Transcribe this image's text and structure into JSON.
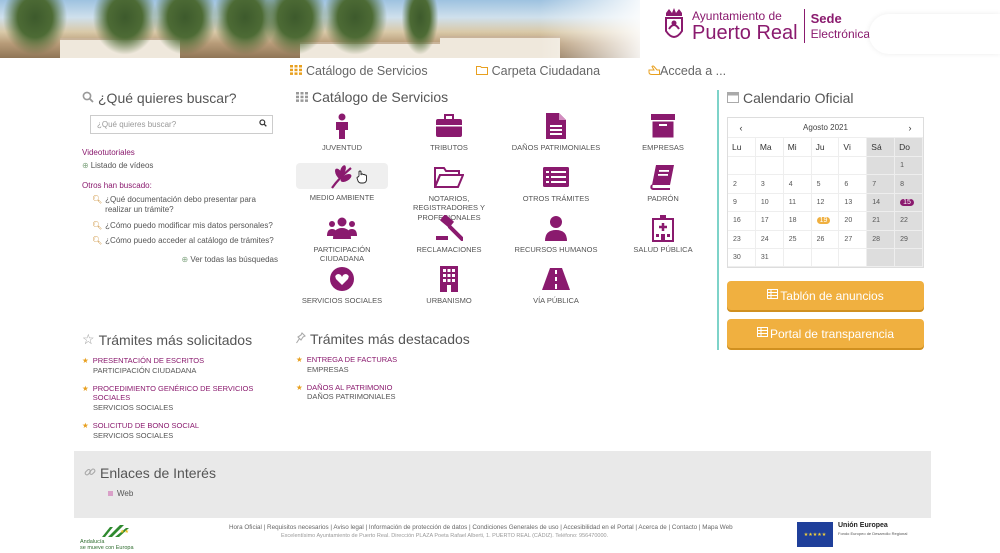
{
  "colors": {
    "brand": "#8a1a6e",
    "accent": "#f0b040",
    "divider": "#7ed3c9"
  },
  "header": {
    "logo_line1": "Ayuntamiento de",
    "logo_line2": "Puerto Real",
    "sede_line1": "Sede",
    "sede_line2": "Electrónica"
  },
  "topnav": [
    {
      "label": "Catálogo de Servicios",
      "icon": "grid-icon"
    },
    {
      "label": "Carpeta Ciudadana",
      "icon": "folder-icon"
    },
    {
      "label": "Acceda a ...",
      "icon": "hand-pointer-icon"
    }
  ],
  "search": {
    "heading": "¿Qué quieres buscar?",
    "placeholder": "¿Qué quieres buscar?",
    "videotutoriales": "Videotutoriales",
    "listado_videos": "Listado de vídeos",
    "otros_title": "Otros han buscado:",
    "queries": [
      "¿Qué documentación debo presentar para realizar un trámite?",
      "¿Cómo puedo modificar mis datos personales?",
      "¿Cómo puedo acceder al catálogo de trámites?"
    ],
    "ver_todas": "Ver todas las búsquedas"
  },
  "catalog": {
    "heading": "Catálogo de Servicios",
    "items": [
      {
        "label": "JUVENTUD",
        "icon": "person-icon"
      },
      {
        "label": "TRIBUTOS",
        "icon": "briefcase-icon"
      },
      {
        "label": "DAÑOS PATRIMONIALES",
        "icon": "document-icon"
      },
      {
        "label": "EMPRESAS",
        "icon": "archive-box-icon"
      },
      {
        "label": "MEDIO AMBIENTE",
        "icon": "leaf-icon"
      },
      {
        "label": "NOTARIOS, REGISTRADORES Y PROFESIONALES",
        "icon": "folder-open-icon"
      },
      {
        "label": "OTROS TRÁMITES",
        "icon": "list-icon"
      },
      {
        "label": "PADRÓN",
        "icon": "book-icon"
      },
      {
        "label": "PARTICIPACIÓN CIUDADANA",
        "icon": "people-icon"
      },
      {
        "label": "RECLAMACIONES",
        "icon": "gavel-icon"
      },
      {
        "label": "RECURSOS HUMANOS",
        "icon": "user-icon"
      },
      {
        "label": "SALUD PÚBLICA",
        "icon": "hospital-icon"
      },
      {
        "label": "SERVICIOS SOCIALES",
        "icon": "heart-icon"
      },
      {
        "label": "URBANISMO",
        "icon": "building-icon"
      },
      {
        "label": "VÍA PÚBLICA",
        "icon": "road-icon"
      }
    ]
  },
  "calendar": {
    "heading": "Calendario Oficial",
    "month": "Agosto 2021",
    "prev": "‹",
    "next": "›",
    "days": [
      "Lu",
      "Ma",
      "Mi",
      "Ju",
      "Vi",
      "Sá",
      "Do"
    ],
    "weeks": [
      [
        "",
        "",
        "",
        "",
        "",
        "",
        "1"
      ],
      [
        "2",
        "3",
        "4",
        "5",
        "6",
        "7",
        "8"
      ],
      [
        "9",
        "10",
        "11",
        "12",
        "13",
        "14",
        "15"
      ],
      [
        "16",
        "17",
        "18",
        "19",
        "20",
        "21",
        "22"
      ],
      [
        "23",
        "24",
        "25",
        "26",
        "27",
        "28",
        "29"
      ],
      [
        "30",
        "31",
        "",
        "",
        "",
        "",
        ""
      ]
    ],
    "today": "19",
    "selected": "15"
  },
  "buttons": {
    "tablon": "Tablón de anuncios",
    "portal": "Portal de transparencia"
  },
  "tramites_solicitados": {
    "heading": "Trámites más solicitados",
    "items": [
      {
        "title": "PRESENTACIÓN DE ESCRITOS",
        "sub": "PARTICIPACIÓN CIUDADANA"
      },
      {
        "title": "PROCEDIMIENTO GENÉRICO DE SERVICIOS SOCIALES",
        "sub": "SERVICIOS SOCIALES"
      },
      {
        "title": "SOLICITUD DE BONO SOCIAL",
        "sub": "SERVICIOS SOCIALES"
      }
    ]
  },
  "tramites_destacados": {
    "heading": "Trámites más destacados",
    "items": [
      {
        "title": "ENTREGA DE FACTURAS",
        "sub": "EMPRESAS"
      },
      {
        "title": "DAÑOS AL PATRIMONIO",
        "sub": "DAÑOS PATRIMONIALES"
      }
    ]
  },
  "enlaces": {
    "heading": "Enlaces de Interés",
    "web": "Web"
  },
  "footer": {
    "links": "Hora Oficial | Requisitos necesarios | Aviso legal | Información de protección de datos | Condiciones Generales de uso | Accesibilidad en el Portal | Acerca de | Contacto | Mapa Web",
    "address": "Excelentísimo Ayuntamiento de Puerto Real. Dirección PLAZA Poeta Rafael Alberti, 1. PUERTO REAL (CÁDIZ). Teléfono: 956470000.",
    "andalucia_1": "Andalucía",
    "andalucia_2": "se mueve con Europa",
    "eu_title": "Unión Europea",
    "eu_sub": "Fondo Europeo de Desarrollo Regional"
  }
}
